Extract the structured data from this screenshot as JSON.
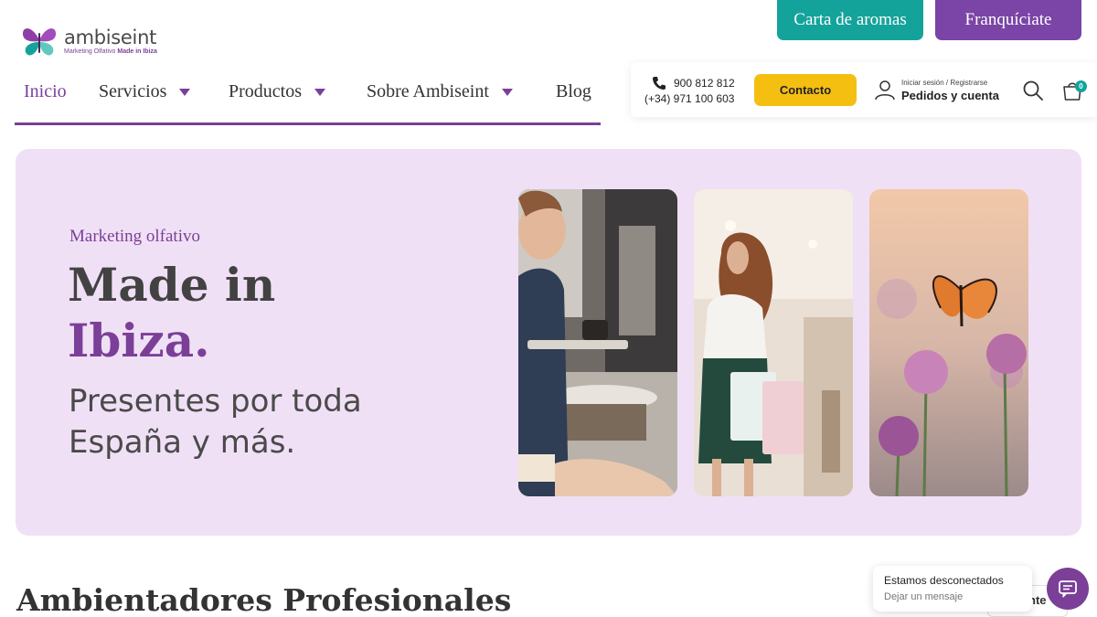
{
  "brand": {
    "name": "ambiseint",
    "tagline_prefix": "Marketing Olfativo ",
    "tagline_bold": "Made in Ibiza",
    "accent": "#7b3f98",
    "teal": "#14a39a",
    "yellow": "#f5bf12"
  },
  "top_buttons": {
    "aromas": "Carta de aromas",
    "franchise": "Franquíciate"
  },
  "nav": {
    "items": [
      {
        "label": "Inicio",
        "active": true,
        "dropdown": false
      },
      {
        "label": "Servicios",
        "dropdown": true
      },
      {
        "label": "Productos",
        "dropdown": true
      },
      {
        "label": "Sobre Ambiseint",
        "dropdown": true
      },
      {
        "label": "Blog",
        "dropdown": false
      }
    ]
  },
  "utility": {
    "phone_main": "900 812 812",
    "phone_alt": "(+34) 971 100 603",
    "contact_label": "Contacto",
    "login_small": "Iniciar sesión / Registrarse",
    "login_big": "Pedidos y cuenta",
    "cart_count": "0",
    "icons": [
      "phone-icon",
      "user-icon",
      "search-icon",
      "cart-icon"
    ]
  },
  "hero": {
    "eyebrow": "Marketing olfativo",
    "title_line1": "Made in",
    "title_line2": "Ibiza.",
    "subtitle_line1": "Presentes por toda",
    "subtitle_line2": "España y más.",
    "background": "#f0e0f5"
  },
  "section": {
    "title": "Ambientadores Profesionales"
  },
  "chat": {
    "status": "Estamos desconectados",
    "sub": "Dejar un mensaje",
    "behind_text": "nte"
  }
}
